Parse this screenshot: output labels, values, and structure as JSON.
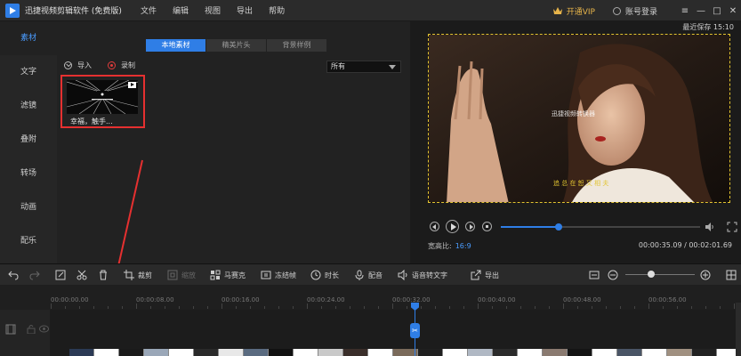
{
  "app": {
    "title": "迅捷视频剪辑软件 (免费版)",
    "menu": [
      "文件",
      "编辑",
      "视图",
      "导出",
      "帮助"
    ],
    "vip_label": "开通VIP",
    "account_label": "账号登录",
    "window_controls": [
      "≡",
      "—",
      "□",
      "✕"
    ],
    "colors": {
      "accent": "#2f7ee6",
      "vip": "#e7b44a",
      "highlight": "#e53030"
    }
  },
  "sidebar": {
    "items": [
      {
        "label": "素材",
        "active": true
      },
      {
        "label": "文字",
        "active": false
      },
      {
        "label": "滤镜",
        "active": false
      },
      {
        "label": "叠附",
        "active": false
      },
      {
        "label": "转场",
        "active": false
      },
      {
        "label": "动画",
        "active": false
      },
      {
        "label": "配乐",
        "active": false
      }
    ]
  },
  "panel": {
    "tabs": [
      "本地素材",
      "精美片头",
      "背景样例"
    ],
    "active_tab": 0,
    "import_label": "导入",
    "record_label": "录制",
    "filter_value": "所有",
    "clips": [
      {
        "label": "幸福，触手..."
      }
    ]
  },
  "preview": {
    "saved_label": "最近保存 15:10",
    "watermark": "迅捷视频转换器",
    "subtitle": "追 总 在   恕 又 相 夫",
    "aspect_label": "宽高比:",
    "aspect_value": "16:9",
    "current_time": "00:00:35.09",
    "total_time": "00:02:01.69",
    "progress": 0.29
  },
  "toolbar": {
    "undo": "undo",
    "redo": "redo",
    "crop_label": "裁剪",
    "zoom_label": "缩放",
    "mosaic_label": "马赛克",
    "freeze_label": "冻结帧",
    "duration_label": "时长",
    "voiceover_label": "配音",
    "speech_to_text_label": "语音转文字",
    "export_label": "导出",
    "zoom_level": 0.37
  },
  "timeline": {
    "ticks": [
      "00:00:00.00",
      "00:00:08.00",
      "00:00:16.00",
      "00:00:24.00",
      "00:00:32.00",
      "00:00:40.00",
      "00:00:48.00",
      "00:00:56.00"
    ],
    "playhead_time": "00:00:35.09"
  }
}
